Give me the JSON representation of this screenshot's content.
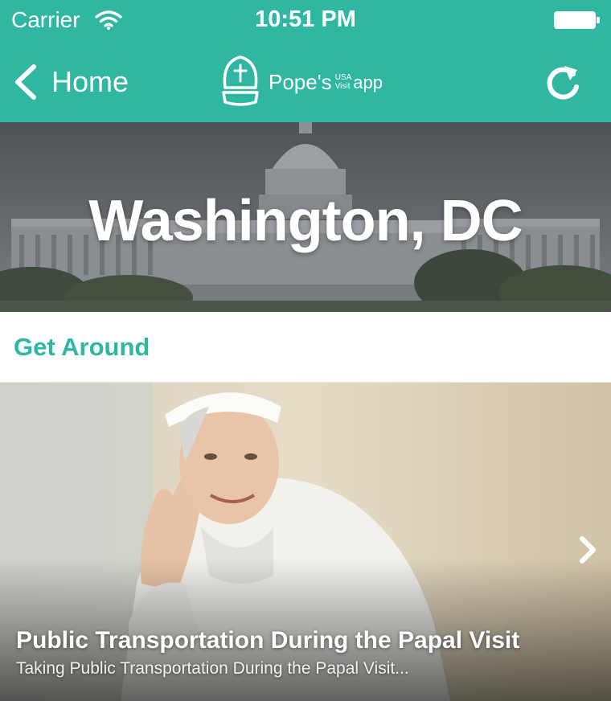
{
  "status_bar": {
    "carrier": "Carrier",
    "time": "10:51 PM",
    "wifi_icon": "wifi-icon",
    "battery_icon": "battery-full-icon"
  },
  "nav": {
    "back_label": "Home",
    "back_icon": "chevron-left-icon",
    "logo": {
      "name": "Pope's",
      "usa": "USA",
      "visit": "Visit",
      "app": "app",
      "icon": "mitre-icon"
    },
    "refresh_icon": "refresh-icon"
  },
  "banner": {
    "city": "Washington, DC",
    "image": "us-capitol-building-photo"
  },
  "section": {
    "title": "Get Around"
  },
  "feature": {
    "title": "Public Transportation During the Papal Visit",
    "subtitle": "Taking Public Transportation During the Papal Visit...",
    "image": "pope-waving-photo",
    "next_icon": "chevron-right-icon"
  },
  "colors": {
    "accent": "#2fb7a1",
    "header_text": "#ffffff"
  }
}
